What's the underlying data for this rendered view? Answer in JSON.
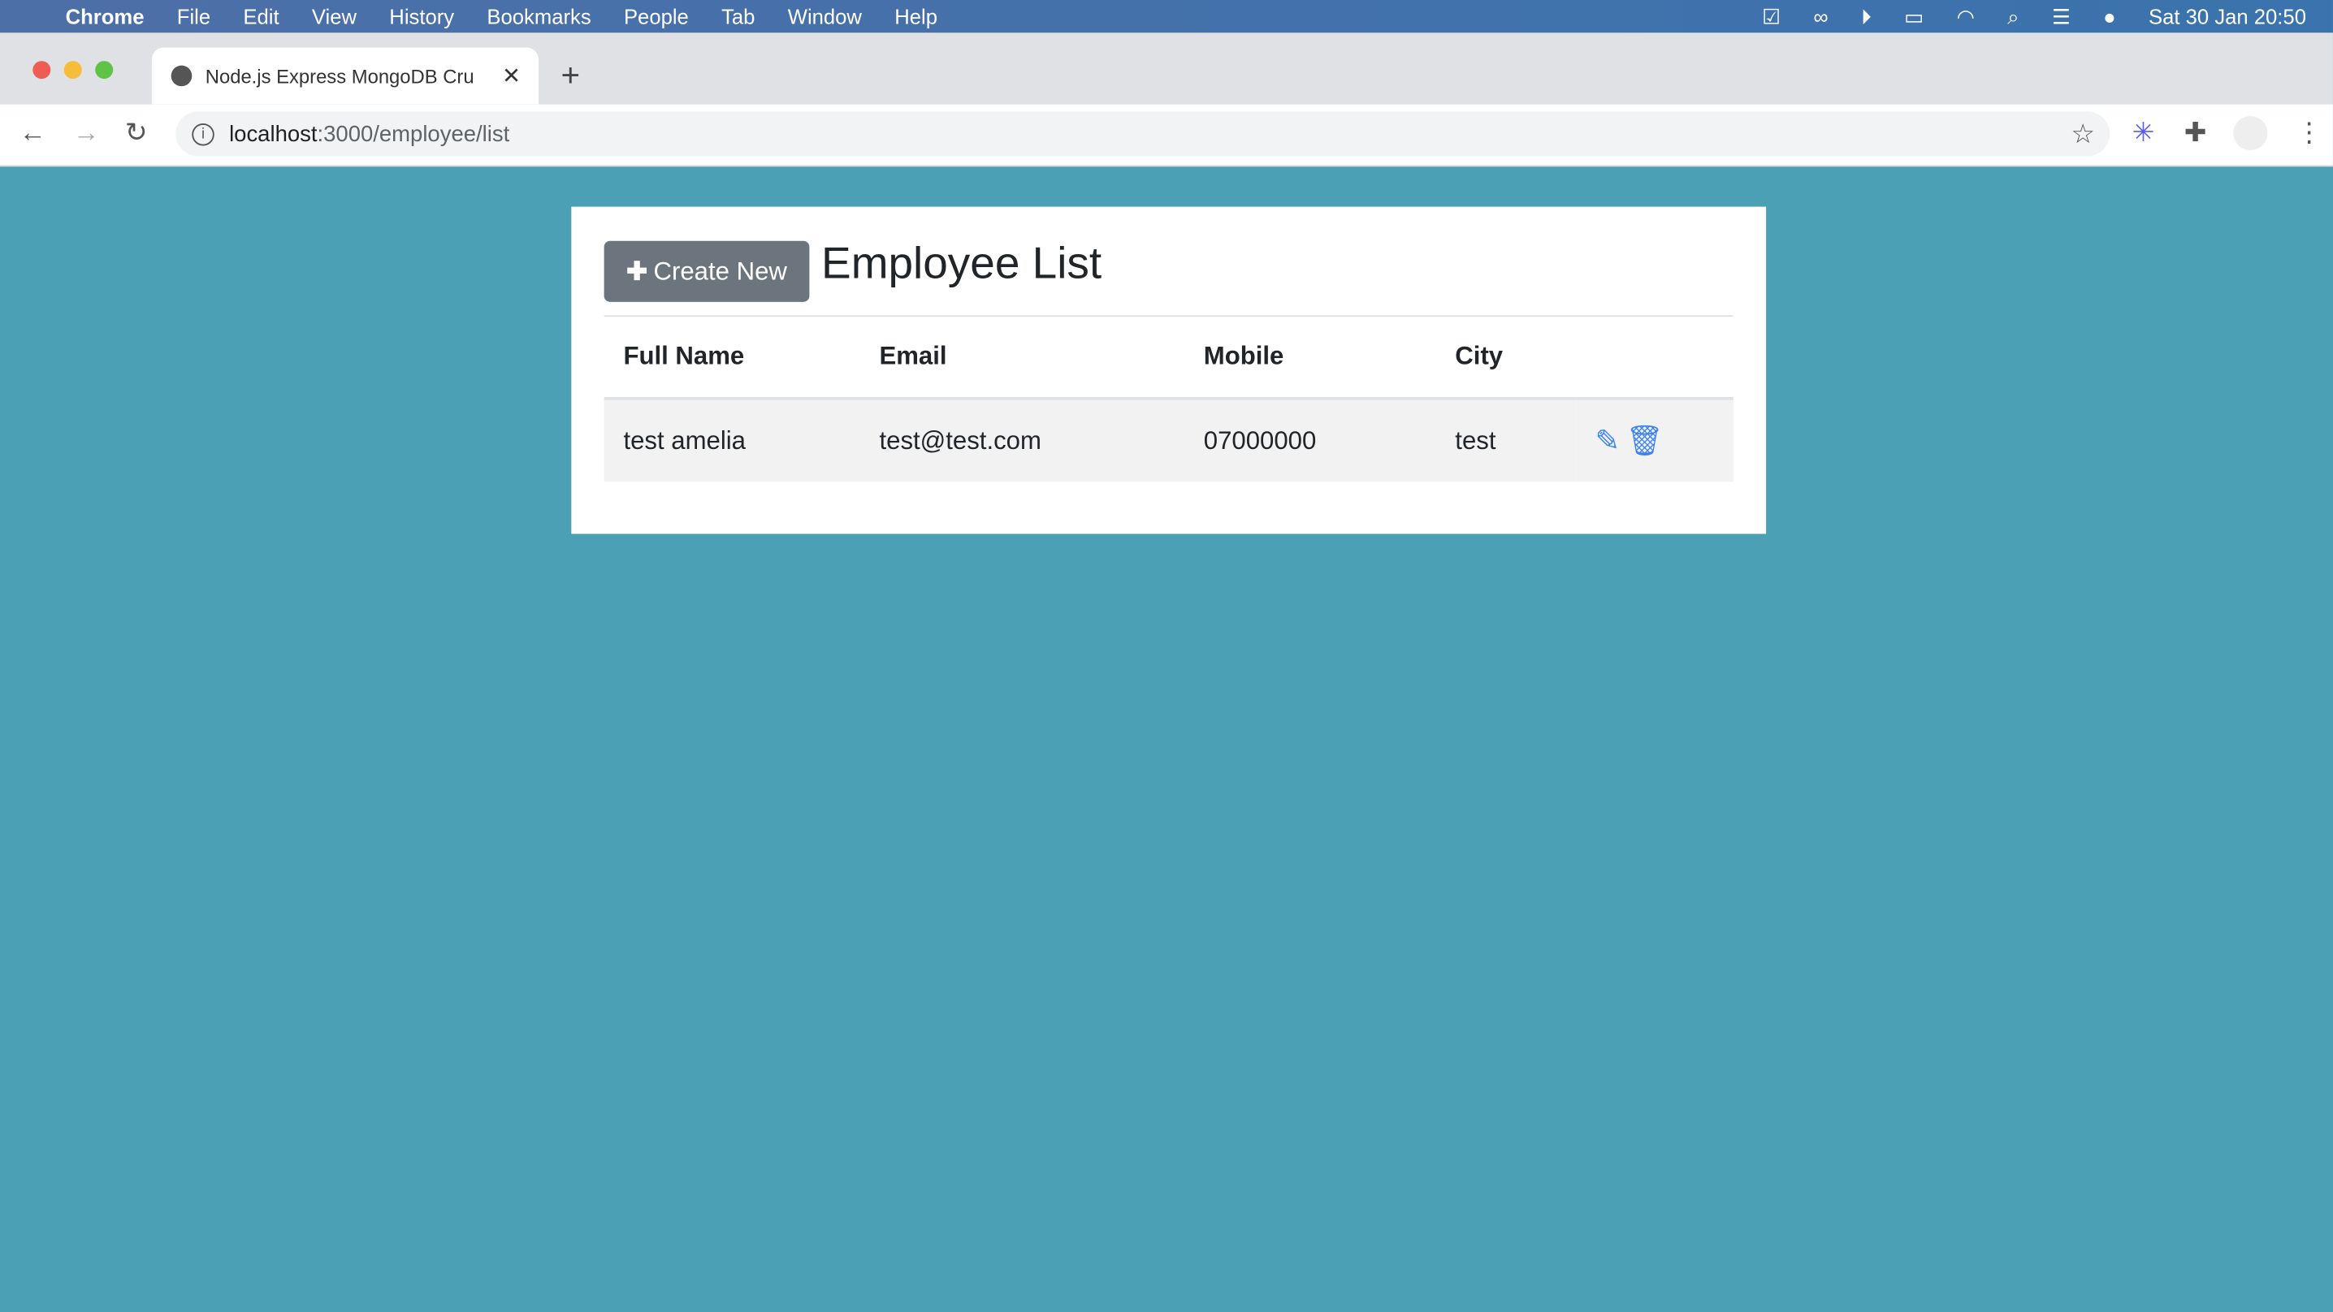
{
  "menubar": {
    "app": "Chrome",
    "items": [
      "File",
      "Edit",
      "View",
      "History",
      "Bookmarks",
      "People",
      "Tab",
      "Window",
      "Help"
    ],
    "clock": "Sat 30 Jan  20:50"
  },
  "browser": {
    "tab_title": "Node.js Express MongoDB Cru",
    "url_host": "localhost",
    "url_path": ":3000/employee/list"
  },
  "page": {
    "create_label": "Create New",
    "title": "Employee List",
    "columns": [
      "Full Name",
      "Email",
      "Mobile",
      "City"
    ],
    "rows": [
      {
        "name": "test amelia",
        "email": "test@test.com",
        "mobile": "07000000",
        "city": "test"
      }
    ]
  },
  "colors": {
    "background": "#4ba0b5",
    "button": "#6c757d",
    "action_icons": "#3b82f6"
  }
}
